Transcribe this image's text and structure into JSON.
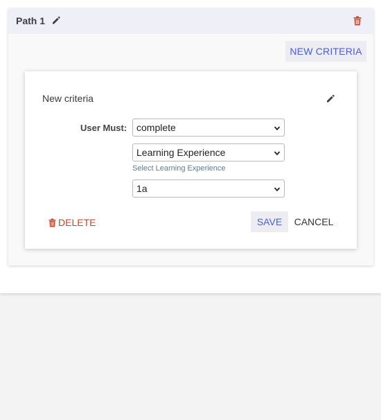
{
  "path": {
    "title": "Path 1",
    "edit_icon": "pencil-icon",
    "delete_icon": "trash-icon",
    "new_criteria_label": "NEW CRITERIA"
  },
  "criteria": {
    "title": "New criteria",
    "edit_icon": "pencil-icon",
    "user_must_label": "User Must:",
    "action_select": {
      "value": "complete"
    },
    "type_select": {
      "value": "Learning Experience",
      "helper": "Select Learning Experience"
    },
    "item_select": {
      "value": "1a"
    },
    "delete_label": "DELETE",
    "save_label": "SAVE",
    "cancel_label": "CANCEL"
  },
  "colors": {
    "accent": "#4a60d6",
    "danger": "#c4452d",
    "header_bg": "#efeff8",
    "button_bg": "#ececf2"
  }
}
